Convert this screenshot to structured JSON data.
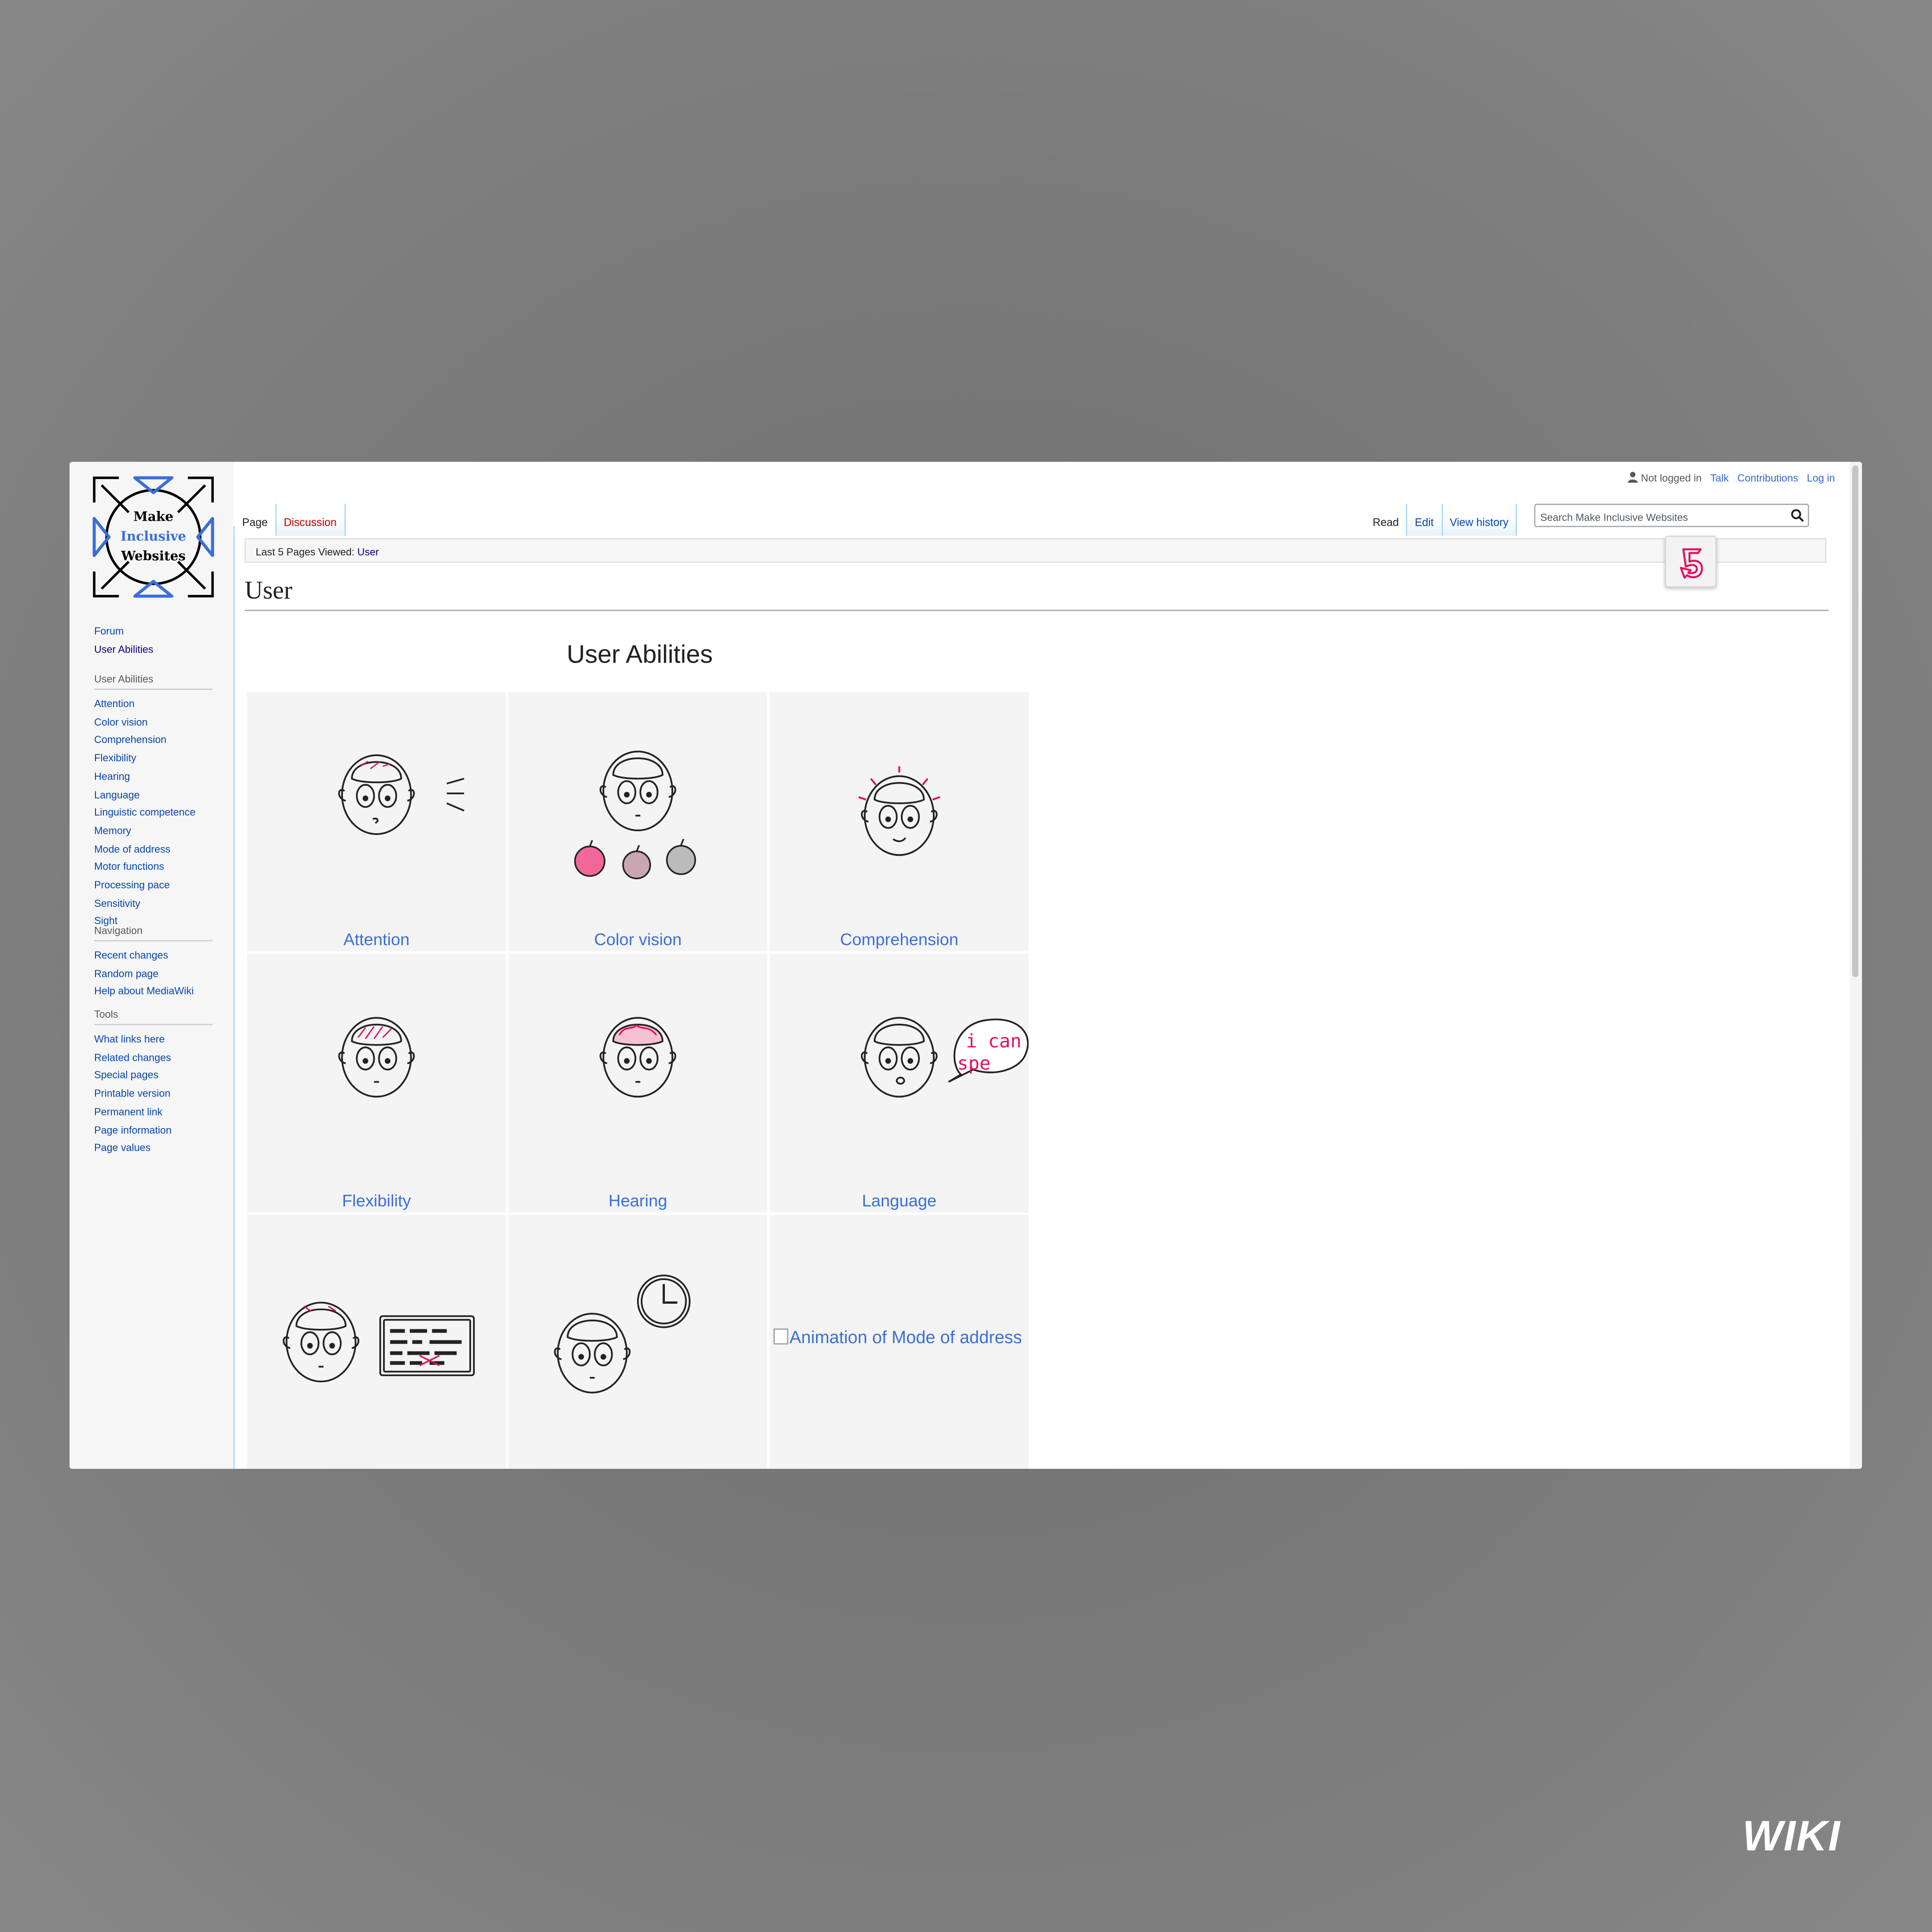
{
  "site": {
    "logo_lines": [
      "Make",
      "Inclusive",
      "Websites"
    ],
    "accent": "#3366cc",
    "link_color": "#0645ad",
    "new_link_color": "#ba0000",
    "highlight_pink": "#e0115f"
  },
  "personal": {
    "not_logged_in": "Not logged in",
    "talk": "Talk",
    "contributions": "Contributions",
    "login": "Log in"
  },
  "tabs": {
    "page": "Page",
    "discussion": "Discussion",
    "read": "Read",
    "edit": "Edit",
    "view_history": "View history"
  },
  "search": {
    "placeholder": "Search Make Inclusive Websites"
  },
  "breadcrumb": {
    "label": "Last 5 Pages Viewed:",
    "current": "User"
  },
  "sidebar": {
    "top_links": [
      {
        "label": "Forum"
      },
      {
        "label": "User Abilities"
      }
    ],
    "sections": [
      {
        "heading": "User Abilities",
        "items": [
          "Attention",
          "Color vision",
          "Comprehension",
          "Flexibility",
          "Hearing",
          "Language",
          "Linguistic competence",
          "Memory",
          "Mode of address",
          "Motor functions",
          "Processing pace",
          "Sensitivity",
          "Sight"
        ]
      },
      {
        "heading": "Navigation",
        "items": [
          "Recent changes",
          "Random page",
          "Help about MediaWiki"
        ]
      },
      {
        "heading": "Tools",
        "items": [
          "What links here",
          "Related changes",
          "Special pages",
          "Printable version",
          "Permanent link",
          "Page information",
          "Page values"
        ]
      }
    ]
  },
  "page": {
    "title": "User",
    "section_title": "User Abilities",
    "cards": [
      {
        "caption": "Attention",
        "icon": "face-attention-icon"
      },
      {
        "caption": "Color vision",
        "icon": "face-apples-icon"
      },
      {
        "caption": "Comprehension",
        "icon": "face-comprehension-icon"
      },
      {
        "caption": "Flexibility",
        "icon": "face-flexibility-icon"
      },
      {
        "caption": "Hearing",
        "icon": "face-hearing-icon"
      },
      {
        "caption": "Language",
        "icon": "face-speech-bubble-icon",
        "bubble_text": [
          "i can",
          "spe"
        ]
      },
      {
        "caption": "",
        "icon": "face-keyboard-icon"
      },
      {
        "caption": "",
        "icon": "face-clock-icon"
      },
      {
        "caption": "",
        "alt_text": "Animation of Mode of address"
      }
    ]
  },
  "badge": {
    "text": "WIKI"
  }
}
